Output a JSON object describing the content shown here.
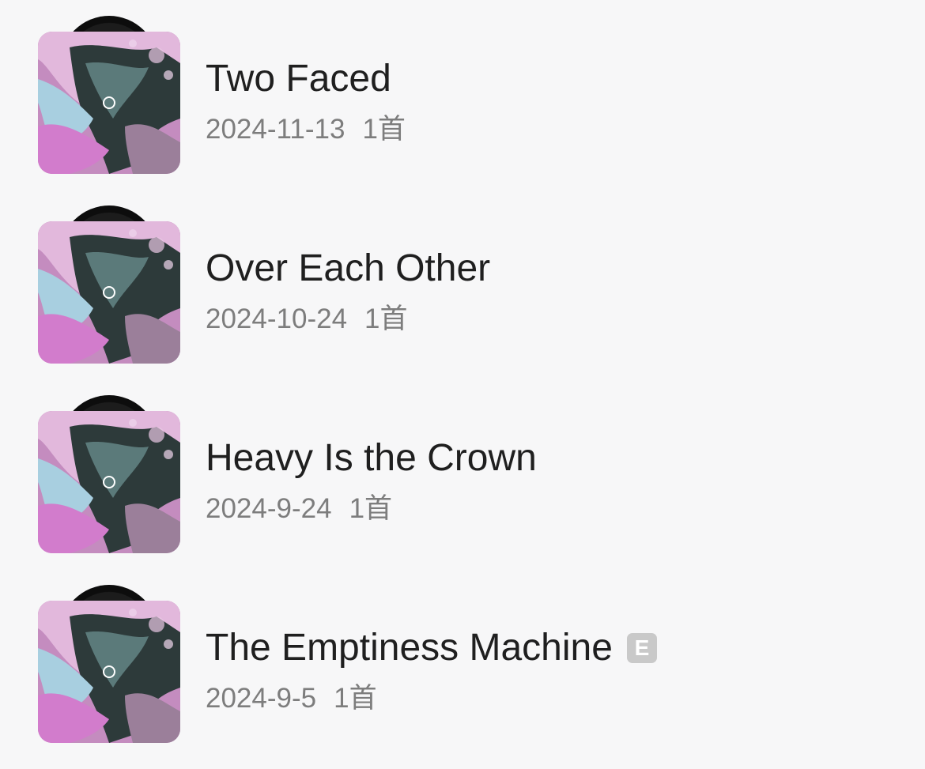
{
  "releases": [
    {
      "title": "Two Faced",
      "date": "2024-11-13",
      "count": "1首",
      "explicit": false
    },
    {
      "title": "Over Each Other",
      "date": "2024-10-24",
      "count": "1首",
      "explicit": false
    },
    {
      "title": "Heavy Is the Crown",
      "date": "2024-9-24",
      "count": "1首",
      "explicit": false
    },
    {
      "title": "The Emptiness Machine",
      "date": "2024-9-5",
      "count": "1首",
      "explicit": true,
      "explicit_label": "E"
    }
  ],
  "colors": {
    "background": "#f7f7f8",
    "title": "#1f1f1f",
    "meta": "#7d7d7d",
    "explicit_badge": "#c9c9c9"
  }
}
